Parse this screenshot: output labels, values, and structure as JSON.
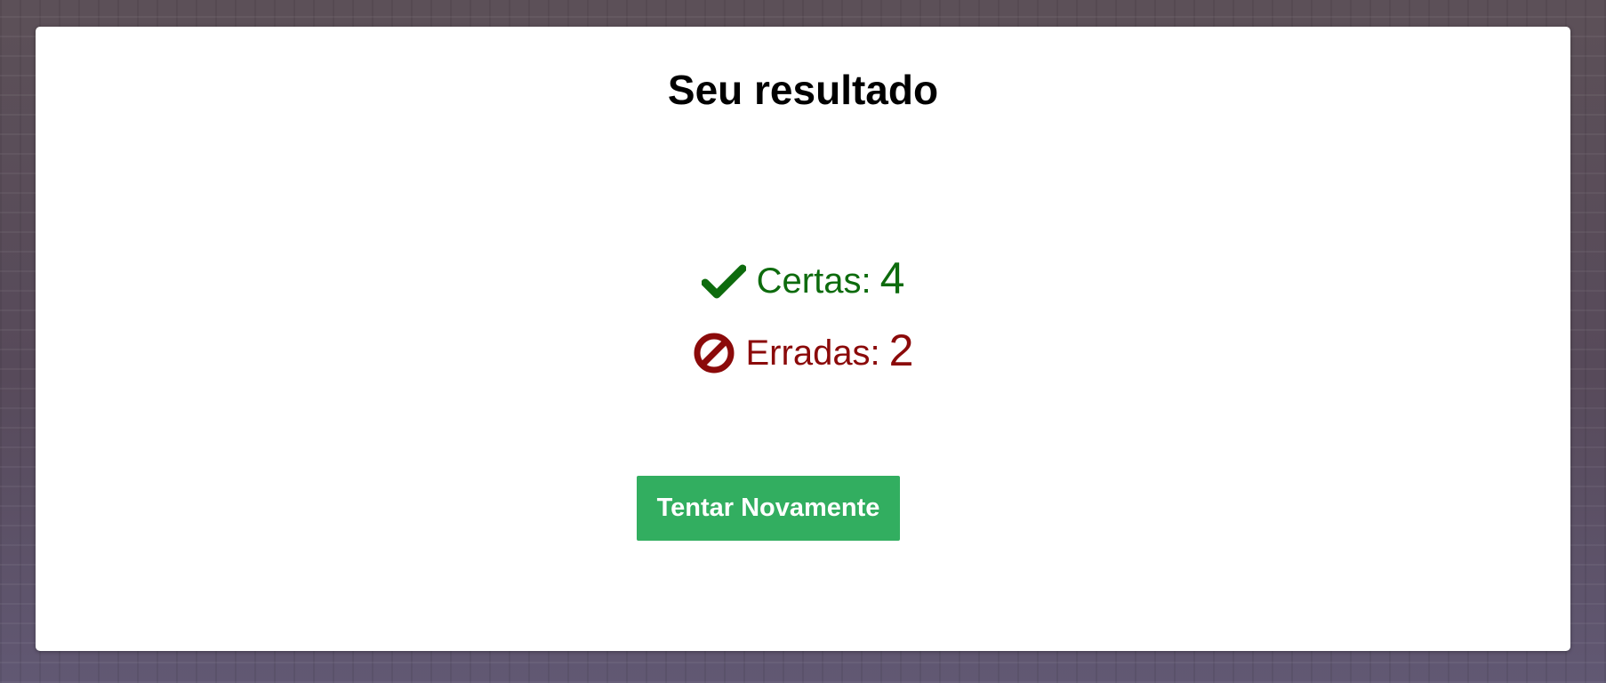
{
  "result": {
    "title": "Seu resultado",
    "correct": {
      "icon": "checkmark-icon",
      "label": "Certas:",
      "value": "4",
      "color": "#0d6b0d"
    },
    "wrong": {
      "icon": "prohibited-icon",
      "label": "Erradas:",
      "value": "2",
      "color": "#8b0a0a"
    },
    "retry_label": "Tentar Novamente",
    "accent": "#32ae60"
  }
}
